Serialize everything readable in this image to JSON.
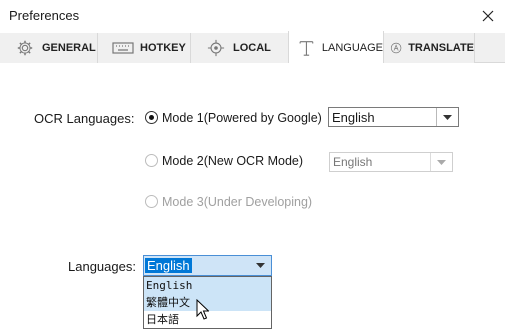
{
  "window": {
    "title": "Preferences"
  },
  "tabs": [
    {
      "label": "GENERAL",
      "icon": "gear-icon"
    },
    {
      "label": "HOTKEY",
      "icon": "keyboard-icon"
    },
    {
      "label": "LOCAL",
      "icon": "target-icon"
    },
    {
      "label": "LANGUAGE",
      "icon": "text-icon",
      "active": true
    },
    {
      "label": "TRANSLATE",
      "icon": "translate-icon"
    }
  ],
  "ocr": {
    "label": "OCR Languages:",
    "modes": [
      {
        "label": "Mode 1(Powered by Google)",
        "checked": true,
        "enabled": true,
        "combo_value": "English"
      },
      {
        "label": "Mode 2(New OCR Mode)",
        "checked": false,
        "enabled": false,
        "combo_value": "English"
      },
      {
        "label": "Mode 3(Under Developing)",
        "checked": false,
        "enabled": false
      }
    ]
  },
  "languages": {
    "label": "Languages:",
    "selected": "English",
    "options": [
      "English",
      "繁體中文",
      "日本語"
    ]
  },
  "colors": {
    "selection": "#0078d7",
    "hover": "#cce4f7",
    "tab_bg": "#f0f0f0"
  }
}
